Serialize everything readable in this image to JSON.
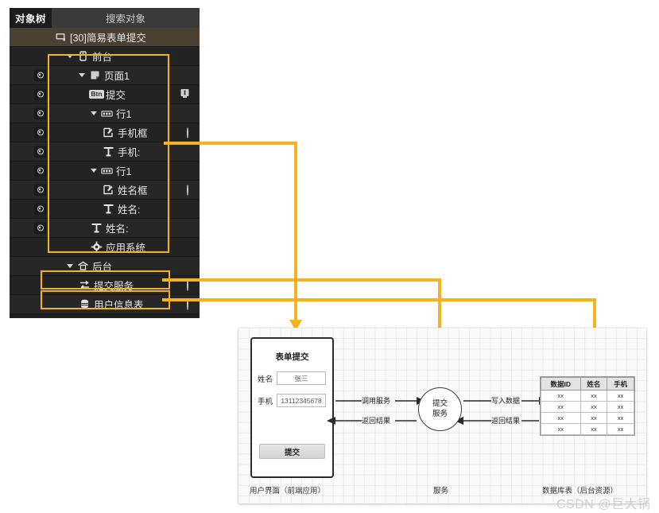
{
  "tree_panel": {
    "tab_label": "对象树",
    "search_placeholder": "搜索对象",
    "rows": [
      {
        "label": "[30]简易表单提交",
        "icon": "project-icon",
        "indent": 1,
        "selected": true,
        "eye": false,
        "caret": false,
        "right": ""
      },
      {
        "label": "前台",
        "icon": "phone-icon",
        "indent": 2,
        "selected": false,
        "eye": false,
        "caret": true,
        "right": ""
      },
      {
        "label": "页面1",
        "icon": "page-icon",
        "indent": 3,
        "selected": false,
        "eye": true,
        "caret": true,
        "right": ""
      },
      {
        "label": "提交",
        "icon": "btn-icon",
        "indent": 4,
        "selected": false,
        "eye": true,
        "caret": false,
        "right": "info"
      },
      {
        "label": "行1",
        "icon": "row-icon",
        "indent": 4,
        "selected": false,
        "eye": true,
        "caret": true,
        "right": ""
      },
      {
        "label": "手机框",
        "icon": "edit-icon",
        "indent": 5,
        "selected": false,
        "eye": true,
        "caret": false,
        "right": "circle"
      },
      {
        "label": "手机:",
        "icon": "text-icon",
        "indent": 5,
        "selected": false,
        "eye": true,
        "caret": false,
        "right": ""
      },
      {
        "label": "行1",
        "icon": "row-icon",
        "indent": 4,
        "selected": false,
        "eye": true,
        "caret": true,
        "right": ""
      },
      {
        "label": "姓名框",
        "icon": "edit-icon",
        "indent": 5,
        "selected": false,
        "eye": true,
        "caret": false,
        "right": "circle"
      },
      {
        "label": "姓名:",
        "icon": "text-icon",
        "indent": 5,
        "selected": false,
        "eye": true,
        "caret": false,
        "right": ""
      },
      {
        "label": "姓名:",
        "icon": "text-icon",
        "indent": 4,
        "selected": false,
        "eye": true,
        "caret": false,
        "right": ""
      },
      {
        "label": "应用系统",
        "icon": "gear-icon",
        "indent": 4,
        "selected": false,
        "eye": false,
        "caret": false,
        "right": ""
      },
      {
        "label": "后台",
        "icon": "server-icon",
        "indent": 2,
        "selected": false,
        "eye": false,
        "caret": true,
        "right": ""
      },
      {
        "label": "提交服务",
        "icon": "service-icon",
        "indent": 3,
        "selected": false,
        "eye": false,
        "caret": false,
        "right": "circle"
      },
      {
        "label": "用户信息表",
        "icon": "table-icon",
        "indent": 3,
        "selected": false,
        "eye": false,
        "caret": false,
        "right": "circle"
      }
    ]
  },
  "diagram": {
    "form": {
      "title": "表单提交",
      "fields": [
        {
          "label": "姓名",
          "value": "张三"
        },
        {
          "label": "手机",
          "value": "13112345678"
        }
      ],
      "submit_label": "提交"
    },
    "service": {
      "line1": "提交",
      "line2": "服务"
    },
    "arrow_labels": {
      "call_service": "调用服务",
      "return_result_left": "返回结果",
      "write_data": "写入数据",
      "return_result_right": "返回结果"
    },
    "table": {
      "headers": [
        "数据ID",
        "姓名",
        "手机"
      ],
      "rows": [
        [
          "xx",
          "xx",
          "xx"
        ],
        [
          "xx",
          "xx",
          "xx"
        ],
        [
          "xx",
          "xx",
          "xx"
        ],
        [
          "xx",
          "xx",
          "xx"
        ]
      ]
    },
    "zone_labels": {
      "ui": "用户界面（前端应用）",
      "service": "服务",
      "database": "数据库表（后台资源）"
    }
  },
  "watermark": "CSDN @巨大锅",
  "colors": {
    "highlight": "#f5b323",
    "panel_bg": "#1f1f1f",
    "row_selected": "#4b4133"
  }
}
